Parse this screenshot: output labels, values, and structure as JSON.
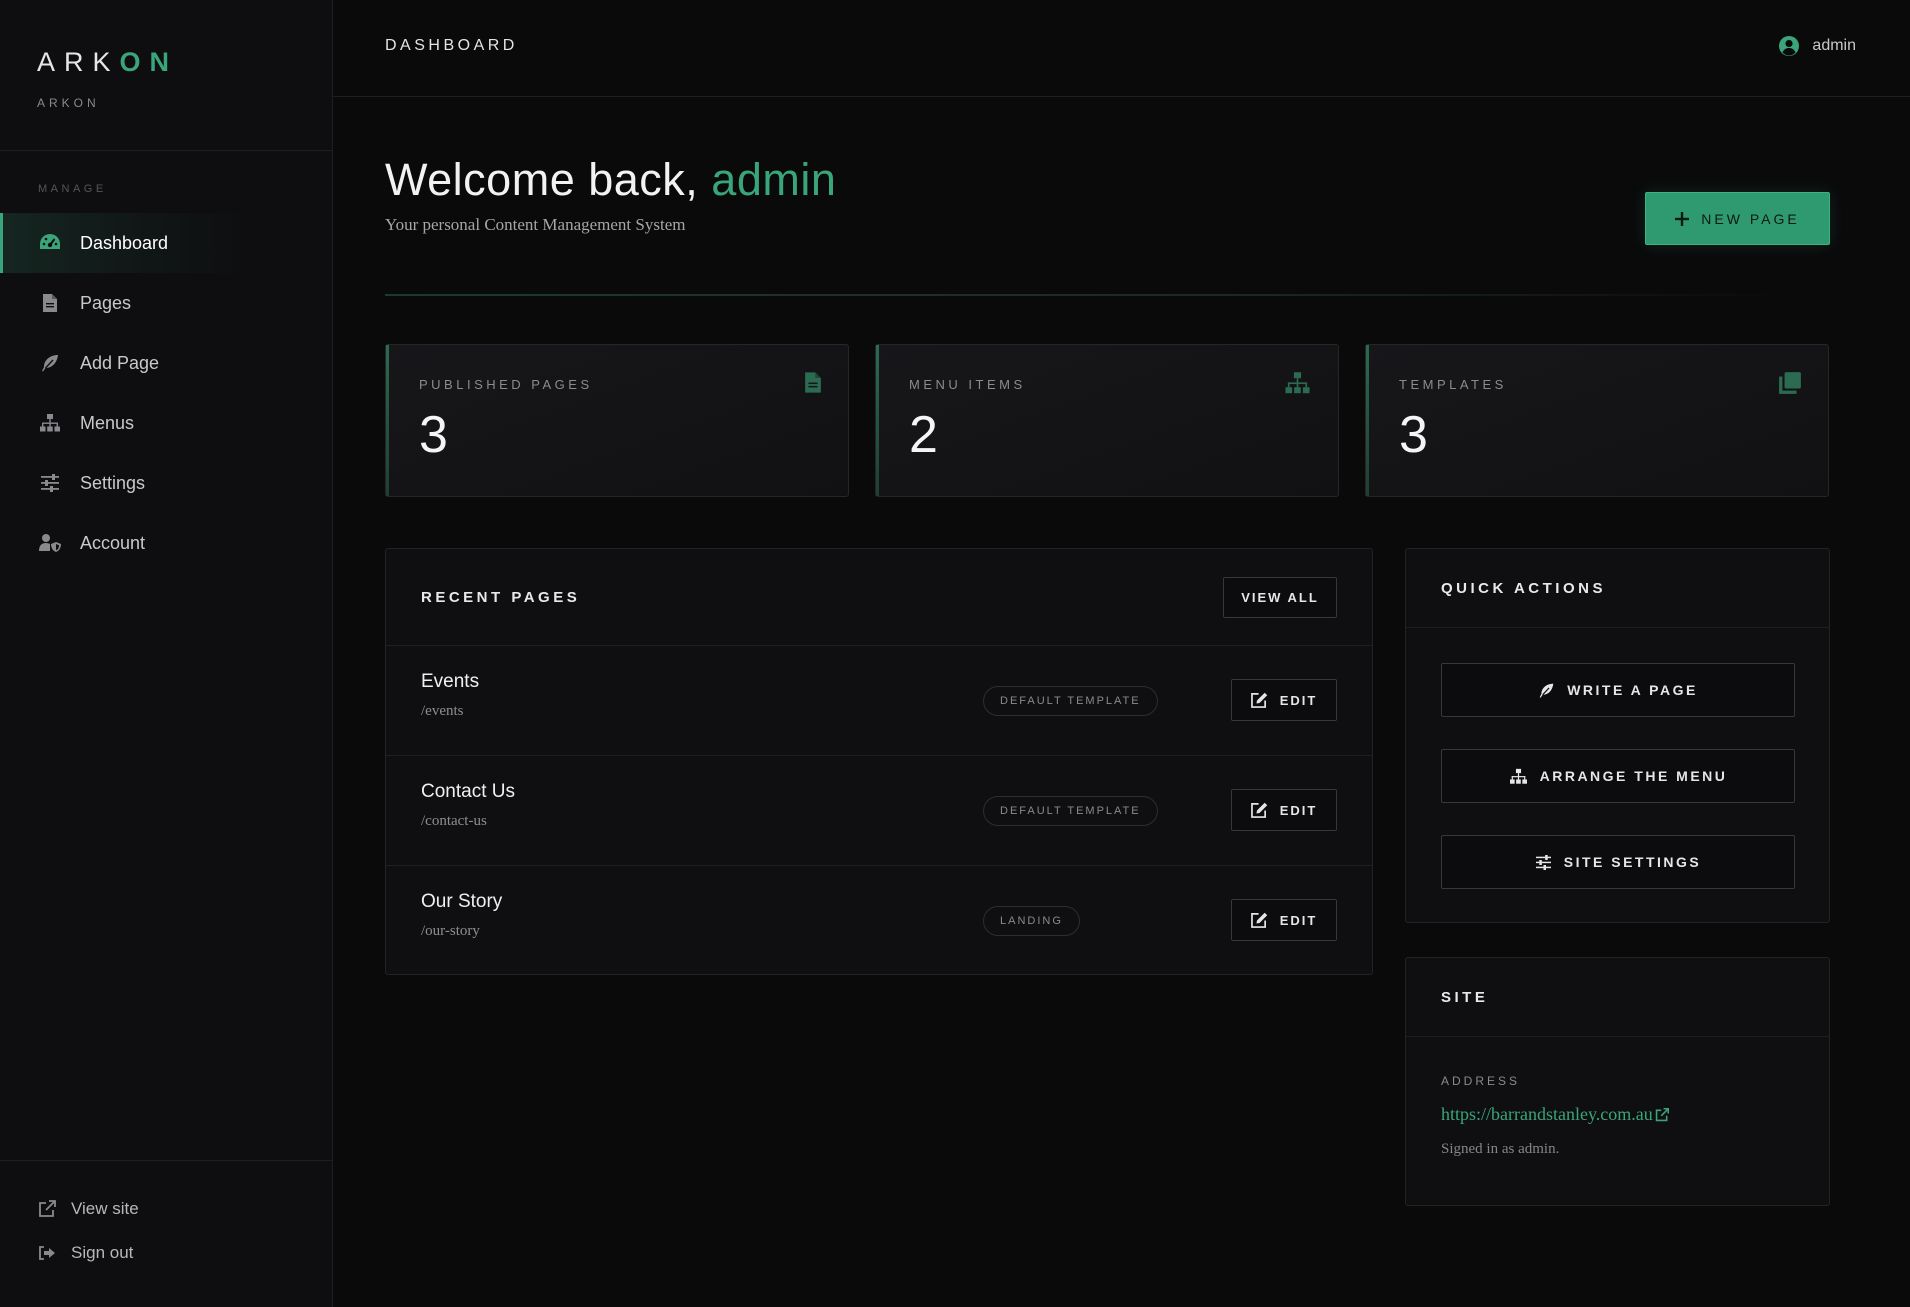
{
  "brand": {
    "logo_main": "ARK",
    "logo_accent": "ON",
    "subtitle": "ARKON"
  },
  "sidebar": {
    "section_label": "MANAGE",
    "items": [
      {
        "label": "Dashboard",
        "icon": "dashboard-icon",
        "active": true
      },
      {
        "label": "Pages",
        "icon": "file-icon"
      },
      {
        "label": "Add Page",
        "icon": "feather-icon"
      },
      {
        "label": "Menus",
        "icon": "sitemap-icon"
      },
      {
        "label": "Settings",
        "icon": "sliders-icon"
      },
      {
        "label": "Account",
        "icon": "user-shield-icon"
      }
    ],
    "footer": [
      {
        "label": "View site",
        "icon": "external-link-icon"
      },
      {
        "label": "Sign out",
        "icon": "sign-out-icon"
      }
    ]
  },
  "topbar": {
    "title": "DASHBOARD",
    "user": "admin"
  },
  "welcome": {
    "prefix": "Welcome back, ",
    "name": "admin",
    "subtitle": "Your personal Content Management System",
    "new_page_label": "NEW PAGE"
  },
  "stats": [
    {
      "label": "PUBLISHED PAGES",
      "value": "3",
      "icon": "file-icon"
    },
    {
      "label": "MENU ITEMS",
      "value": "2",
      "icon": "sitemap-icon"
    },
    {
      "label": "TEMPLATES",
      "value": "3",
      "icon": "clone-icon"
    }
  ],
  "recent": {
    "title": "RECENT PAGES",
    "view_all": "VIEW ALL",
    "edit_label": "EDIT",
    "rows": [
      {
        "name": "Events",
        "slug": "/events",
        "template": "DEFAULT TEMPLATE"
      },
      {
        "name": "Contact Us",
        "slug": "/contact-us",
        "template": "DEFAULT TEMPLATE"
      },
      {
        "name": "Our Story",
        "slug": "/our-story",
        "template": "LANDING"
      }
    ]
  },
  "quick": {
    "title": "QUICK ACTIONS",
    "actions": [
      {
        "label": "WRITE A PAGE",
        "icon": "feather-icon"
      },
      {
        "label": "ARRANGE THE MENU",
        "icon": "sitemap-icon"
      },
      {
        "label": "SITE SETTINGS",
        "icon": "sliders-icon"
      }
    ]
  },
  "site": {
    "title": "SITE",
    "address_label": "ADDRESS",
    "url": "https://barrandstanley.com.au",
    "note": "Signed in as admin."
  },
  "colors": {
    "accent": "#3aa57a",
    "background": "#0a0a0b",
    "sidebar": "#0e0e10",
    "panel": "#0f0f11"
  }
}
